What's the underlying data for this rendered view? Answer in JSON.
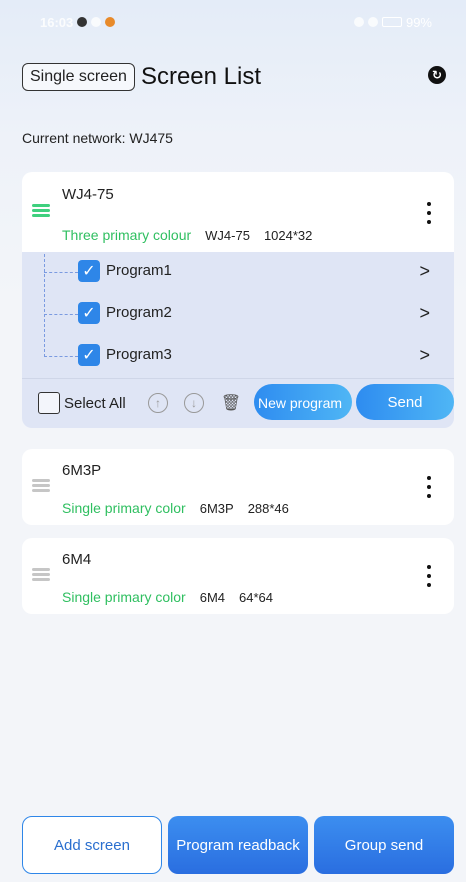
{
  "status_bar": {
    "time": "16:03",
    "battery": "99%"
  },
  "header": {
    "single_screen_label": "Single screen",
    "title": "Screen List"
  },
  "network": {
    "label": "Current network: WJ475"
  },
  "screens": [
    {
      "name": "WJ4-75",
      "color_type": "Three primary colour",
      "model": "WJ4-75",
      "resolution": "1024*32",
      "icon": "led-screen-icon",
      "status_color": "#3fd07e"
    },
    {
      "name": "6M3P",
      "color_type": "Single primary color",
      "model": "6M3P",
      "resolution": "288*46",
      "icon": "led-screen-icon",
      "status_color": "#c6c6c6"
    },
    {
      "name": "6M4",
      "color_type": "Single primary color",
      "model": "6M4",
      "resolution": "64*64",
      "icon": "led-screen-icon",
      "status_color": "#c6c6c6"
    }
  ],
  "programs": [
    {
      "name": "Program1",
      "checked": true
    },
    {
      "name": "Program2",
      "checked": true
    },
    {
      "name": "Program3",
      "checked": true
    }
  ],
  "toolbar": {
    "select_all_label": "Select All",
    "new_program_label": "New program",
    "send_label": "Send"
  },
  "bottom_bar": {
    "add_screen_label": "Add screen",
    "program_readback_label": "Program readback",
    "group_send_label": "Group send"
  },
  "colors": {
    "accent": "#2e86e8",
    "color_type_text": "#2fbf60"
  }
}
